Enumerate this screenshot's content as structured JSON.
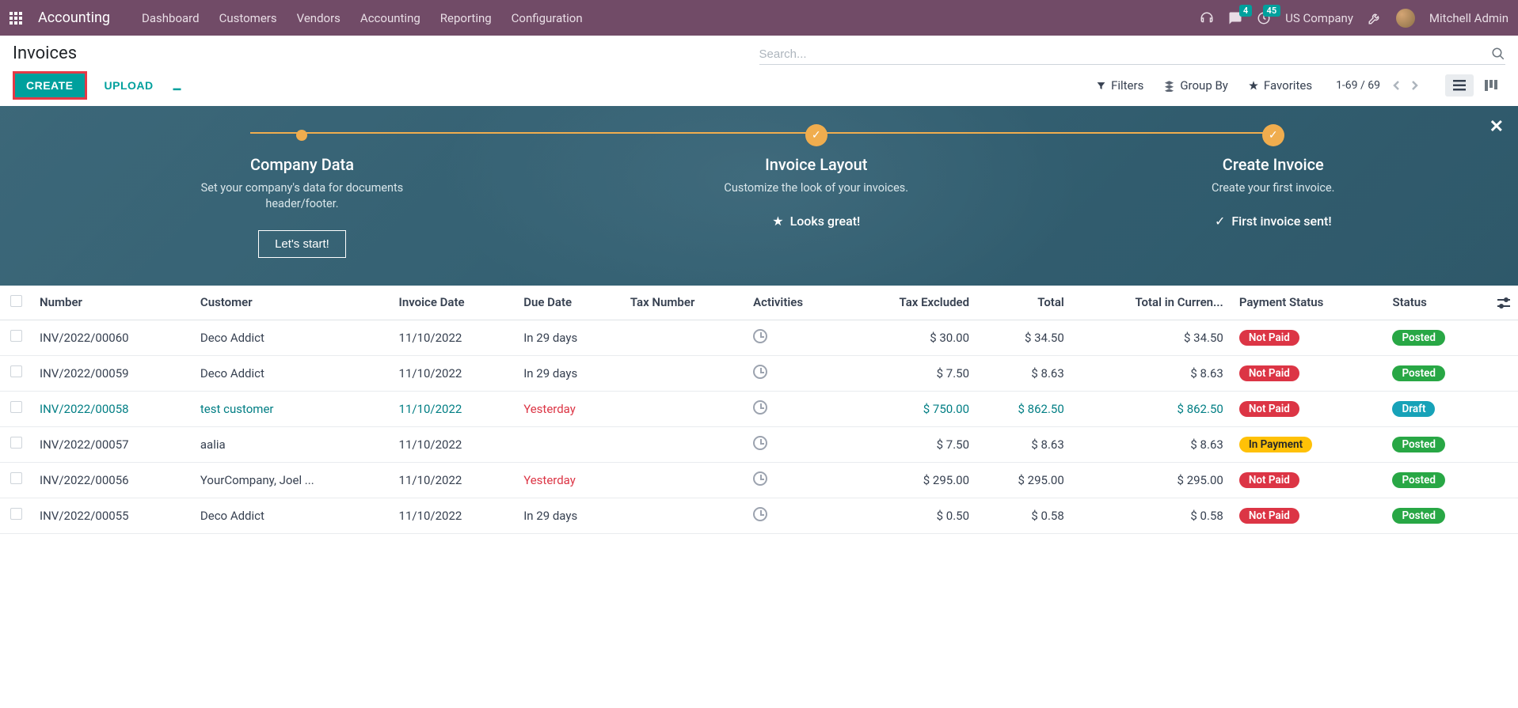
{
  "navbar": {
    "brand": "Accounting",
    "menu": [
      "Dashboard",
      "Customers",
      "Vendors",
      "Accounting",
      "Reporting",
      "Configuration"
    ],
    "badges": {
      "chat": "4",
      "clock": "45"
    },
    "company": "US Company",
    "user": "Mitchell Admin"
  },
  "page": {
    "title": "Invoices",
    "search_placeholder": "Search...",
    "create_label": "CREATE",
    "upload_label": "UPLOAD"
  },
  "filters": {
    "filters_label": "Filters",
    "groupby_label": "Group By",
    "favorites_label": "Favorites"
  },
  "pager": {
    "text": "1-69 / 69"
  },
  "onboarding": {
    "steps": [
      {
        "title": "Company Data",
        "desc": "Set your company's data for documents header/footer.",
        "button": "Let's start!",
        "done": false
      },
      {
        "title": "Invoice Layout",
        "desc": "Customize the look of your invoices.",
        "status": "Looks great!",
        "done": true
      },
      {
        "title": "Create Invoice",
        "desc": "Create your first invoice.",
        "status": "First invoice sent!",
        "done": true
      }
    ]
  },
  "table": {
    "headers": {
      "number": "Number",
      "customer": "Customer",
      "invoice_date": "Invoice Date",
      "due_date": "Due Date",
      "tax_number": "Tax Number",
      "activities": "Activities",
      "tax_excluded": "Tax Excluded",
      "total": "Total",
      "total_currency": "Total in Curren...",
      "payment_status": "Payment Status",
      "status": "Status"
    },
    "rows": [
      {
        "number": "INV/2022/00060",
        "customer": "Deco Addict",
        "invoice_date": "11/10/2022",
        "due_date": "In 29 days",
        "due_red": false,
        "tax_excluded": "$ 30.00",
        "total": "$ 34.50",
        "total_currency": "$ 34.50",
        "payment_status": "Not Paid",
        "payment_color": "red",
        "status": "Posted",
        "status_color": "green",
        "selected": false
      },
      {
        "number": "INV/2022/00059",
        "customer": "Deco Addict",
        "invoice_date": "11/10/2022",
        "due_date": "In 29 days",
        "due_red": false,
        "tax_excluded": "$ 7.50",
        "total": "$ 8.63",
        "total_currency": "$ 8.63",
        "payment_status": "Not Paid",
        "payment_color": "red",
        "status": "Posted",
        "status_color": "green",
        "selected": false
      },
      {
        "number": "INV/2022/00058",
        "customer": "test customer",
        "invoice_date": "11/10/2022",
        "due_date": "Yesterday",
        "due_red": true,
        "tax_excluded": "$ 750.00",
        "total": "$ 862.50",
        "total_currency": "$ 862.50",
        "payment_status": "Not Paid",
        "payment_color": "red",
        "status": "Draft",
        "status_color": "blue",
        "selected": true
      },
      {
        "number": "INV/2022/00057",
        "customer": "aalia",
        "invoice_date": "11/10/2022",
        "due_date": "",
        "due_red": false,
        "tax_excluded": "$ 7.50",
        "total": "$ 8.63",
        "total_currency": "$ 8.63",
        "payment_status": "In Payment",
        "payment_color": "orange",
        "status": "Posted",
        "status_color": "green",
        "selected": false
      },
      {
        "number": "INV/2022/00056",
        "customer": "YourCompany, Joel ...",
        "invoice_date": "11/10/2022",
        "due_date": "Yesterday",
        "due_red": true,
        "tax_excluded": "$ 295.00",
        "total": "$ 295.00",
        "total_currency": "$ 295.00",
        "payment_status": "Not Paid",
        "payment_color": "red",
        "status": "Posted",
        "status_color": "green",
        "selected": false
      },
      {
        "number": "INV/2022/00055",
        "customer": "Deco Addict",
        "invoice_date": "11/10/2022",
        "due_date": "In 29 days",
        "due_red": false,
        "tax_excluded": "$ 0.50",
        "total": "$ 0.58",
        "total_currency": "$ 0.58",
        "payment_status": "Not Paid",
        "payment_color": "red",
        "status": "Posted",
        "status_color": "green",
        "selected": false
      }
    ]
  }
}
